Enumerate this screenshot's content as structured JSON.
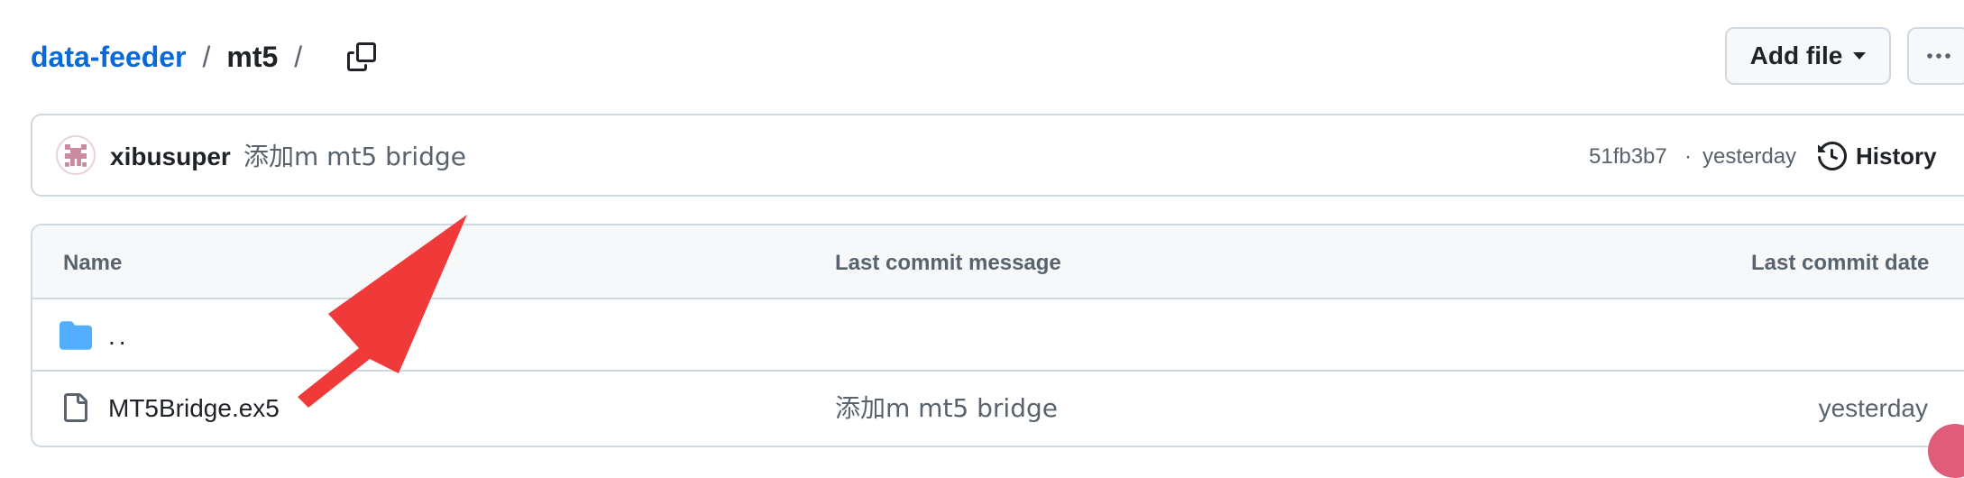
{
  "breadcrumb": {
    "repo": "data-feeder",
    "separator": "/",
    "folder": "mt5",
    "trailing_separator": "/"
  },
  "toolbar": {
    "copy_icon": "copy-icon",
    "add_file_label": "Add file",
    "more_icon": "kebab-horizontal-icon"
  },
  "commit": {
    "author": "xibusuper",
    "message": "添加m mt5 bridge",
    "hash": "51fb3b7",
    "dot": "·",
    "when": "yesterday",
    "history_label": "History"
  },
  "table": {
    "headers": {
      "name": "Name",
      "message": "Last commit message",
      "date": "Last commit date"
    },
    "rows": [
      {
        "icon": "folder-icon",
        "name": "..",
        "message": "",
        "date": ""
      },
      {
        "icon": "file-icon",
        "name": "MT5Bridge.ex5",
        "message": "添加m mt5 bridge",
        "date": "yesterday"
      }
    ]
  },
  "colors": {
    "link": "#0969da",
    "muted": "#59636e",
    "border": "#d1d9e0",
    "folder": "#54aeff",
    "annotation": "#f03a3a"
  }
}
